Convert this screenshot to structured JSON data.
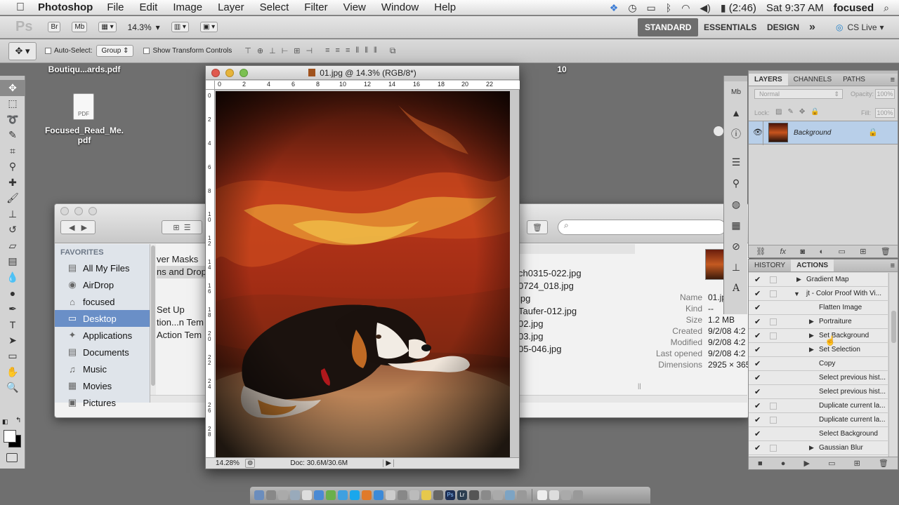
{
  "menubar": {
    "app_name": "Photoshop",
    "items": [
      "File",
      "Edit",
      "Image",
      "Layer",
      "Select",
      "Filter",
      "View",
      "Window",
      "Help"
    ],
    "battery": "(2:46)",
    "clock": "Sat 9:37 AM",
    "user": "focused"
  },
  "appbar": {
    "ps_logo": "Ps",
    "br_label": "Br",
    "mb_label": "Mb",
    "zoom": "14.3%",
    "workspaces": [
      "STANDARD",
      "ESSENTIALS",
      "DESIGN"
    ],
    "more": "»",
    "cslive": "CS Live"
  },
  "options": {
    "auto_select_label": "Auto-Select:",
    "auto_select_value": "Group",
    "transform_label": "Show Transform Controls"
  },
  "desktop": {
    "file1": "Boutiqu...ards.pdf",
    "file2": "Focused_Read_Me.\npdf",
    "number": "10"
  },
  "finder": {
    "sidebar_header": "FAVORITES",
    "sidebar": [
      {
        "label": "All My Files",
        "icon": "all-files-icon"
      },
      {
        "label": "AirDrop",
        "icon": "airdrop-icon"
      },
      {
        "label": "focused",
        "icon": "home-icon"
      },
      {
        "label": "Desktop",
        "icon": "desktop-icon"
      },
      {
        "label": "Applications",
        "icon": "applications-icon"
      },
      {
        "label": "Documents",
        "icon": "documents-icon"
      },
      {
        "label": "Music",
        "icon": "music-icon"
      },
      {
        "label": "Movies",
        "icon": "movies-icon"
      },
      {
        "label": "Pictures",
        "icon": "pictures-icon"
      }
    ],
    "col1": [
      "ver Masks",
      "ns and Drop",
      "",
      "",
      "Set Up",
      "tion...n Tem",
      "Action Tem"
    ],
    "col2": [
      "ch0315-022.jpg",
      "0724_018.jpg",
      "jpg",
      "Taufer-012.jpg",
      "02.jpg",
      "03.jpg",
      "05-046.jpg"
    ],
    "info": [
      {
        "label": "Name",
        "value": "01.jp"
      },
      {
        "label": "Kind",
        "value": "--"
      },
      {
        "label": "Size",
        "value": "1.2 MB"
      },
      {
        "label": "Created",
        "value": "9/2/08 4:2"
      },
      {
        "label": "Modified",
        "value": "9/2/08 4:2"
      },
      {
        "label": "Last opened",
        "value": "9/2/08 4:2"
      },
      {
        "label": "Dimensions",
        "value": "2925 × 365"
      }
    ]
  },
  "document": {
    "title": "01.jpg @ 14.3% (RGB/8*)",
    "zoom": "14.28%",
    "doc_info": "Doc: 30.6M/30.6M",
    "ruler_top": [
      "0",
      "2",
      "4",
      "6",
      "8",
      "10",
      "12",
      "14",
      "16",
      "18",
      "20",
      "22"
    ],
    "ruler_left": [
      "0",
      "2",
      "4",
      "6",
      "8",
      "1\n0",
      "1\n2",
      "1\n4",
      "1\n6",
      "1\n8",
      "2\n0",
      "2\n2",
      "2\n4",
      "2\n6",
      "2\n8"
    ]
  },
  "layers": {
    "tabs": [
      "LAYERS",
      "CHANNELS",
      "PATHS"
    ],
    "blend": "Normal",
    "opacity_label": "Opacity:",
    "opacity": "100%",
    "lock_label": "Lock:",
    "fill_label": "Fill:",
    "fill": "100%",
    "layer_name": "Background"
  },
  "actions": {
    "tabs": [
      "HISTORY",
      "ACTIONS"
    ],
    "rows": [
      {
        "label": "Gradient Map",
        "indent": 1,
        "arrow": "▶"
      },
      {
        "label": "jt - Color Proof With Vi...",
        "indent": 0,
        "arrow": "▼"
      },
      {
        "label": "Flatten Image",
        "indent": 2,
        "arrow": ""
      },
      {
        "label": "Portraiture",
        "indent": 2,
        "arrow": "▶"
      },
      {
        "label": "Set Background",
        "indent": 2,
        "arrow": "▶"
      },
      {
        "label": "Set Selection",
        "indent": 2,
        "arrow": "▶"
      },
      {
        "label": "Copy",
        "indent": 2,
        "arrow": ""
      },
      {
        "label": "Select previous hist...",
        "indent": 2,
        "arrow": ""
      },
      {
        "label": "Select previous hist...",
        "indent": 2,
        "arrow": ""
      },
      {
        "label": "Duplicate current la...",
        "indent": 2,
        "arrow": ""
      },
      {
        "label": "Duplicate current la...",
        "indent": 2,
        "arrow": ""
      },
      {
        "label": "Select Background",
        "indent": 2,
        "arrow": ""
      },
      {
        "label": "Gaussian Blur",
        "indent": 2,
        "arrow": "▶"
      }
    ]
  },
  "colors": {
    "selection_blue": "#6a8fc7",
    "layer_highlight": "#b8cfe9"
  }
}
